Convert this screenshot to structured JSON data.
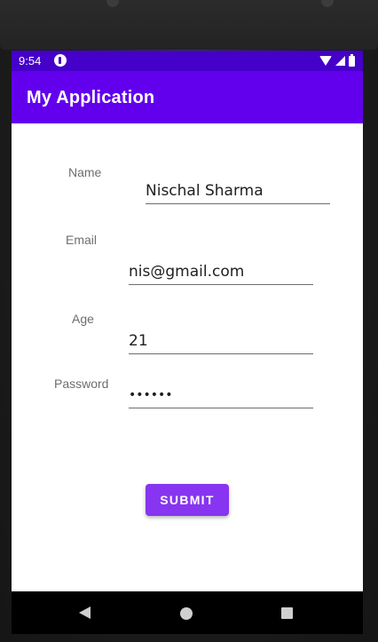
{
  "status_bar": {
    "time": "9:54",
    "icons": [
      "app-notification-icon",
      "wifi-icon",
      "signal-icon",
      "battery-icon"
    ]
  },
  "app_bar": {
    "title": "My Application",
    "color": "#6200ee"
  },
  "form": {
    "name_label": "Name",
    "name_value": "Nischal Sharma",
    "email_label": "Email",
    "email_value": "nis@gmail.com",
    "age_label": "Age",
    "age_value": "21",
    "password_label": "Password",
    "password_value": "nischa"
  },
  "submit_label": "SUBMIT",
  "nav_bar": {
    "icons": [
      "back-icon",
      "home-icon",
      "recents-icon"
    ]
  },
  "colors": {
    "status_bar": "#4500c9",
    "app_bar": "#6200ee",
    "button": "#8735f0"
  }
}
